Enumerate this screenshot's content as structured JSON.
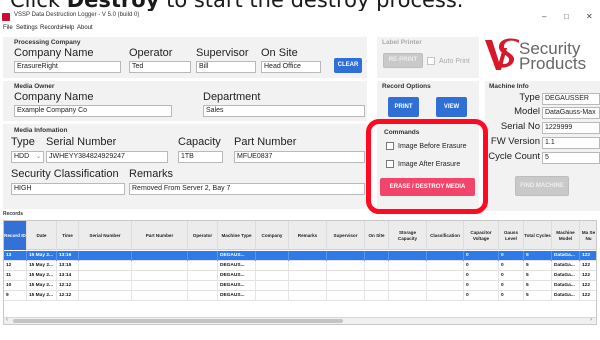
{
  "caption": {
    "prefix": "Click ",
    "bold": "Destroy",
    "suffix": " to start the destroy process."
  },
  "window": {
    "title": "VSSP Data Destruction Logger - V 5.0 (build 0)",
    "minimize": "–",
    "maximize": "□",
    "close": "✕"
  },
  "menu": [
    "File",
    "Settings",
    "Records",
    "Help",
    "About"
  ],
  "processing": {
    "title": "Processing Company",
    "company_label": "Company Name",
    "company_value": "ErasureRight",
    "operator_label": "Operator",
    "operator_value": "Ted",
    "supervisor_label": "Supervisor",
    "supervisor_value": "Bill",
    "onsite_label": "On Site",
    "onsite_value": "Head Office",
    "clear": "CLEAR"
  },
  "label_printer": {
    "title": "Label Printer",
    "reprint": "RE-PRINT",
    "auto_print": "Auto Print"
  },
  "logo": {
    "line1": "Security",
    "line2": "Products"
  },
  "media_owner": {
    "title": "Media Owner",
    "company_label": "Company Name",
    "company_value": "Example Company Co",
    "dept_label": "Department",
    "dept_value": "Sales"
  },
  "record_options": {
    "title": "Record Options",
    "print": "PRINT",
    "view": "VIEW"
  },
  "machine_info": {
    "title": "Machine Info",
    "type_label": "Type",
    "type_value": "DEGAUSSER",
    "model_label": "Model",
    "model_value": "DataGauss-Max",
    "serial_label": "Serial No",
    "serial_value": "1229999",
    "fw_label": "FW Version",
    "fw_value": "1.1",
    "cycle_label": "Cycle Count",
    "cycle_value": "5",
    "find": "FIND MACHINE"
  },
  "media_info": {
    "title": "Media Infomation",
    "type_label": "Type",
    "type_value": "HDD",
    "serial_label": "Serial Number",
    "serial_value": "JWHEYY3848249292​47",
    "capacity_label": "Capacity",
    "capacity_value": "1TB",
    "part_label": "Part Number",
    "part_value": "MFUE0837",
    "security_label": "Security Classification",
    "security_value": "HIGH",
    "remarks_label": "Remarks",
    "remarks_value": "Removed From Server 2, Bay 7"
  },
  "commands": {
    "title": "Commands",
    "before": "Image Before Erasure",
    "after": "Image After Erasure",
    "erase": "ERASE / DESTROY MEDIA"
  },
  "records": {
    "title": "Records",
    "headers": [
      "Record ID",
      "Date",
      "Time",
      "Serial Number",
      "Part Number",
      "Operator",
      "Machine Type",
      "Company",
      "Remarks",
      "Supervisor",
      "On Site",
      "Storage Capacity",
      "Classification",
      "Capacitor Voltage",
      "Gauss Level",
      "Total Cycles",
      "Machine Model",
      "Ma Se Nu"
    ],
    "rows": [
      [
        "13",
        "15 May 2...",
        "13:16",
        "",
        "",
        "",
        "DEGAUS...",
        "",
        "",
        "",
        "",
        "",
        "",
        "0",
        "0",
        "5",
        "DataGa...",
        "122"
      ],
      [
        "12",
        "15 May 2...",
        "13:15",
        "",
        "",
        "",
        "DEGAUS...",
        "",
        "",
        "",
        "",
        "",
        "",
        "0",
        "0",
        "5",
        "DataGa...",
        "122"
      ],
      [
        "11",
        "15 May 2...",
        "13:14",
        "",
        "",
        "",
        "DEGAUS...",
        "",
        "",
        "",
        "",
        "",
        "",
        "0",
        "0",
        "5",
        "DataGa...",
        "122"
      ],
      [
        "10",
        "15 May 2...",
        "12:12",
        "",
        "",
        "",
        "DEGAUS...",
        "",
        "",
        "",
        "",
        "",
        "",
        "0",
        "0",
        "5",
        "DataGa...",
        "122"
      ],
      [
        "9",
        "15 May 2...",
        "12:12",
        "",
        "",
        "",
        "DEGAUS...",
        "",
        "",
        "",
        "",
        "",
        "",
        "0",
        "0",
        "5",
        "DataGa...",
        "122"
      ]
    ]
  },
  "colors": {
    "accent_blue": "#2f6fd6",
    "erase_pink": "#f2456c",
    "highlight_red": "#ff0a22",
    "logo_red": "#d7192a"
  }
}
